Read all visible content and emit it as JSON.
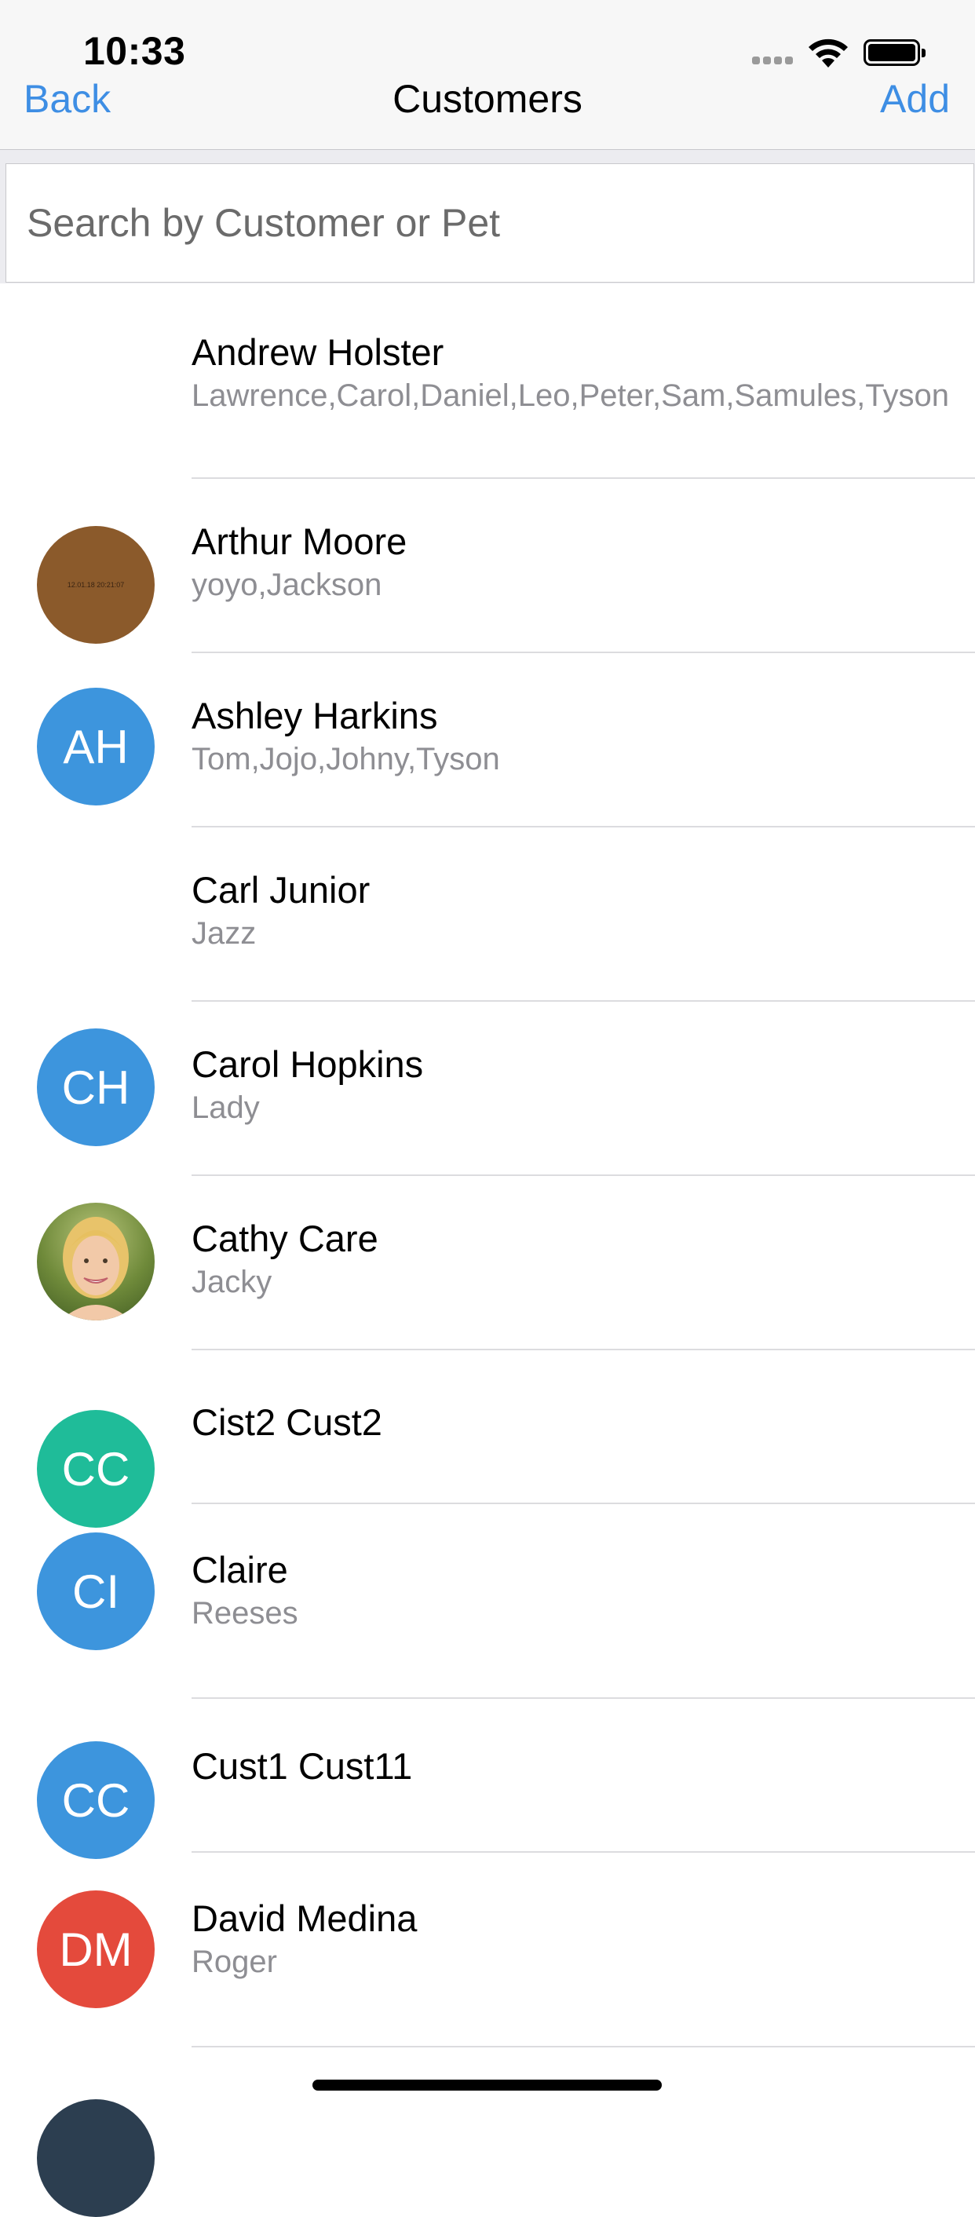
{
  "status_bar": {
    "time": "10:33"
  },
  "nav": {
    "back_label": "Back",
    "title": "Customers",
    "add_label": "Add"
  },
  "search": {
    "placeholder": "Search by Customer or Pet",
    "value": ""
  },
  "colors": {
    "accent": "#3e8ee4",
    "avatar_blue": "#3d95dd",
    "avatar_teal": "#1fbc99",
    "avatar_red": "#e44a3c",
    "avatar_brown": "#8b5a2b"
  },
  "customers": [
    {
      "name": "Andrew Holster",
      "pets": "Lawrence,Carol,Daniel,Leo,Peter,Sam,Samules,Tyson",
      "avatar": {
        "type": "none"
      }
    },
    {
      "name": "Arthur Moore",
      "pets": "yoyo,Jackson",
      "avatar": {
        "type": "photo",
        "color": "#8b5a2b",
        "caption": "12.01.18 20:21:07"
      }
    },
    {
      "name": "Ashley Harkins",
      "pets": "Tom,Jojo,Johny,Tyson",
      "avatar": {
        "type": "initials",
        "initials": "AH",
        "color": "#3d95dd"
      }
    },
    {
      "name": "Carl Junior",
      "pets": "Jazz",
      "avatar": {
        "type": "none"
      }
    },
    {
      "name": "Carol Hopkins",
      "pets": "Lady",
      "avatar": {
        "type": "initials",
        "initials": "CH",
        "color": "#3d95dd"
      }
    },
    {
      "name": "Cathy Care",
      "pets": "Jacky",
      "avatar": {
        "type": "portrait"
      }
    },
    {
      "name": "Cist2 Cust2",
      "pets": "",
      "avatar": {
        "type": "initials",
        "initials": "CC",
        "color": "#1fbc99"
      }
    },
    {
      "name": "Claire",
      "pets": "Reeses",
      "avatar": {
        "type": "initials",
        "initials": "CI",
        "color": "#3d95dd"
      }
    },
    {
      "name": "Cust1 Cust11",
      "pets": "",
      "avatar": {
        "type": "initials",
        "initials": "CC",
        "color": "#3d95dd"
      }
    },
    {
      "name": "David Medina",
      "pets": "Roger",
      "avatar": {
        "type": "initials",
        "initials": "DM",
        "color": "#e44a3c"
      }
    }
  ]
}
